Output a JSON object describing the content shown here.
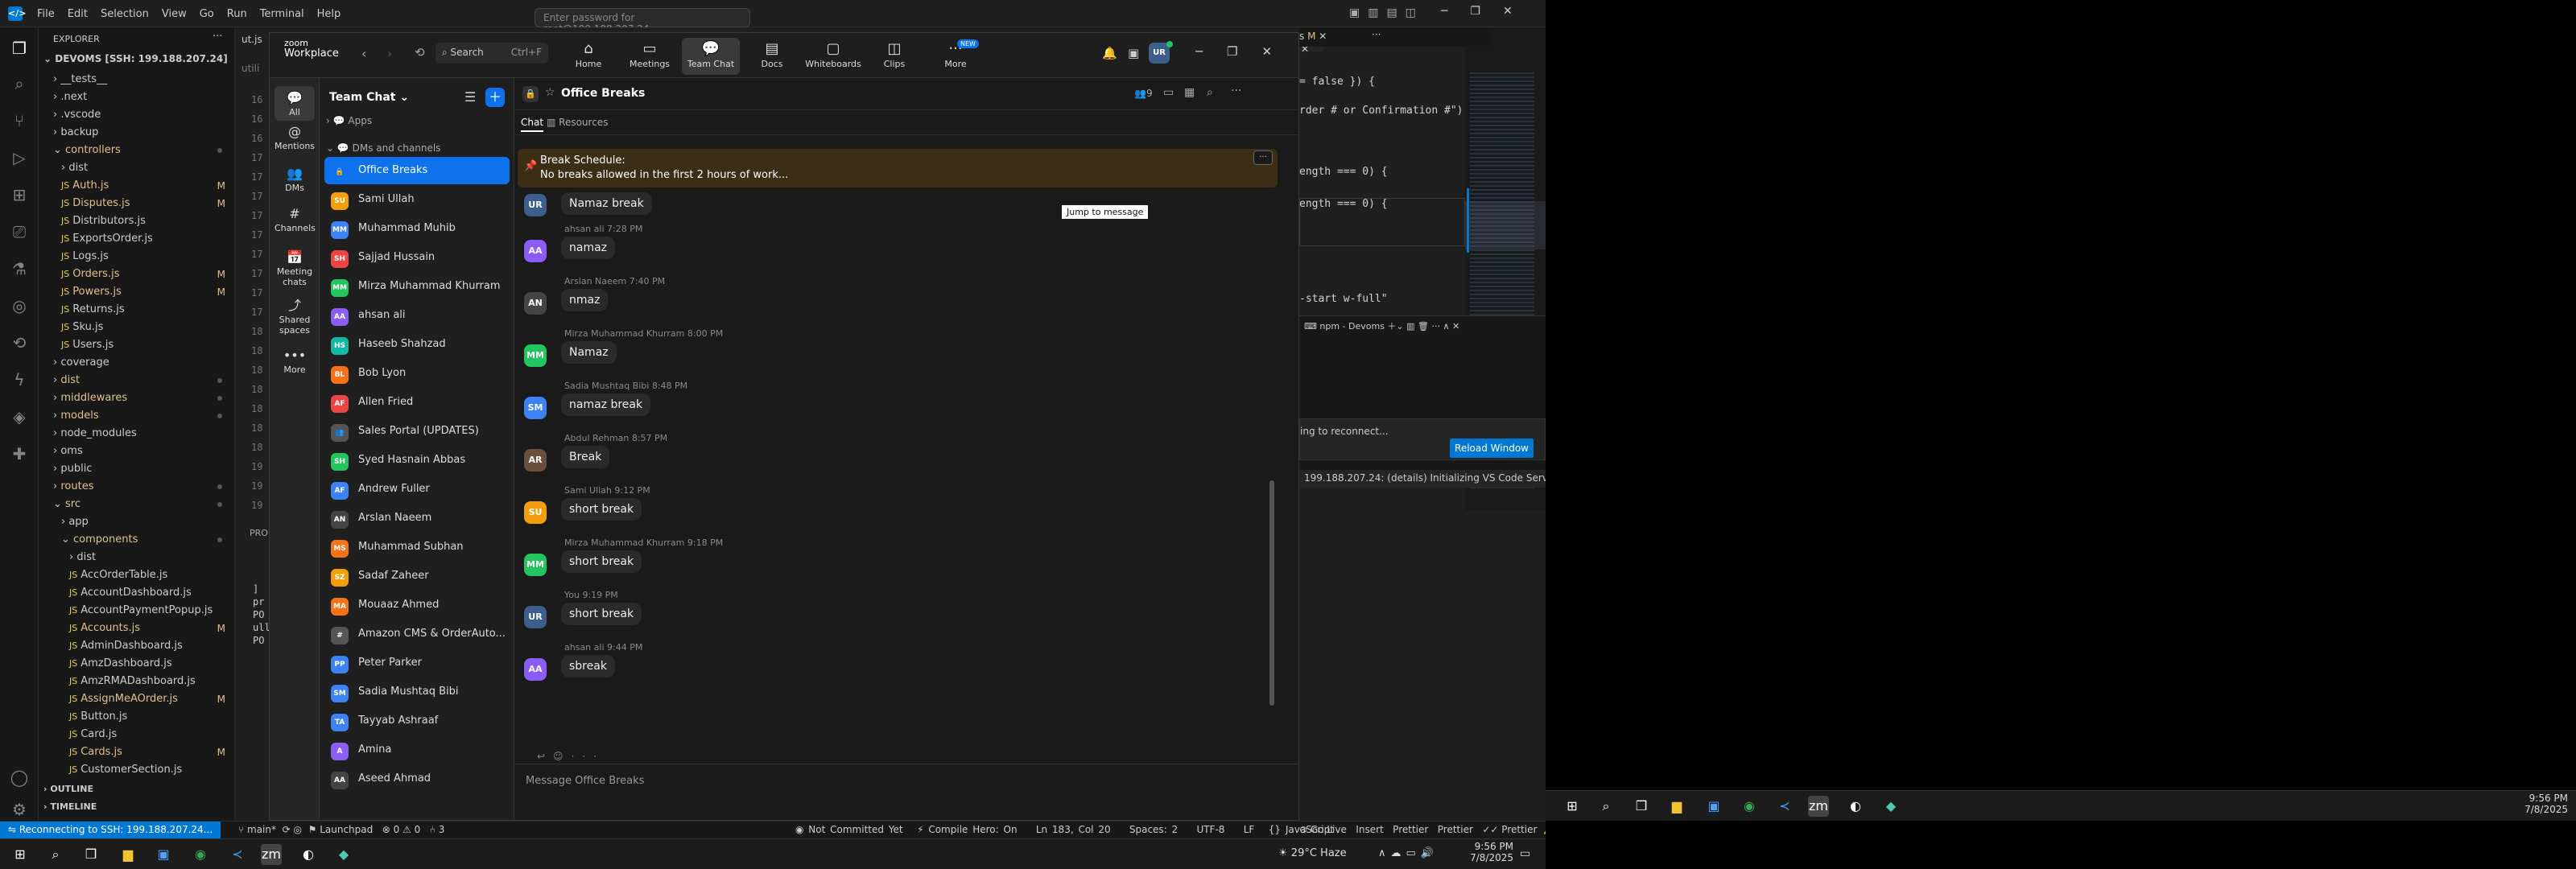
{
  "vscode": {
    "menu": [
      "File",
      "Edit",
      "Selection",
      "View",
      "Go",
      "Run",
      "Terminal",
      "Help"
    ],
    "command_center": "Enter password for root@199.188.207.24",
    "explorer_title": "EXPLORER",
    "root_folder": "DEVOMS [SSH: 199.188.207.24]",
    "tree": [
      {
        "label": "__tests__",
        "depth": 1,
        "type": "folder"
      },
      {
        "label": ".next",
        "depth": 1,
        "type": "folder"
      },
      {
        "label": ".vscode",
        "depth": 1,
        "type": "folder"
      },
      {
        "label": "backup",
        "depth": 1,
        "type": "folder"
      },
      {
        "label": "controllers",
        "depth": 1,
        "type": "folder-open",
        "dot": true
      },
      {
        "label": "dist",
        "depth": 2,
        "type": "folder"
      },
      {
        "label": "Auth.js",
        "depth": 2,
        "type": "js",
        "mark": "M"
      },
      {
        "label": "Disputes.js",
        "depth": 2,
        "type": "js",
        "mark": "M"
      },
      {
        "label": "Distributors.js",
        "depth": 2,
        "type": "js"
      },
      {
        "label": "ExportsOrder.js",
        "depth": 2,
        "type": "js"
      },
      {
        "label": "Logs.js",
        "depth": 2,
        "type": "js"
      },
      {
        "label": "Orders.js",
        "depth": 2,
        "type": "js",
        "mark": "M"
      },
      {
        "label": "Powers.js",
        "depth": 2,
        "type": "js",
        "mark": "M"
      },
      {
        "label": "Returns.js",
        "depth": 2,
        "type": "js"
      },
      {
        "label": "Sku.js",
        "depth": 2,
        "type": "js"
      },
      {
        "label": "Users.js",
        "depth": 2,
        "type": "js"
      },
      {
        "label": "coverage",
        "depth": 1,
        "type": "folder"
      },
      {
        "label": "dist",
        "depth": 1,
        "type": "folder",
        "dot": true
      },
      {
        "label": "middlewares",
        "depth": 1,
        "type": "folder",
        "dot": true
      },
      {
        "label": "models",
        "depth": 1,
        "type": "folder",
        "dot": true
      },
      {
        "label": "node_modules",
        "depth": 1,
        "type": "folder"
      },
      {
        "label": "oms",
        "depth": 1,
        "type": "folder"
      },
      {
        "label": "public",
        "depth": 1,
        "type": "folder"
      },
      {
        "label": "routes",
        "depth": 1,
        "type": "folder",
        "dot": true
      },
      {
        "label": "src",
        "depth": 1,
        "type": "folder-open",
        "dot": true
      },
      {
        "label": "app",
        "depth": 2,
        "type": "folder"
      },
      {
        "label": "components",
        "depth": 2,
        "type": "folder-open",
        "dot": true
      },
      {
        "label": "dist",
        "depth": 3,
        "type": "folder"
      },
      {
        "label": "AccOrderTable.js",
        "depth": 3,
        "type": "js"
      },
      {
        "label": "AccountDashboard.js",
        "depth": 3,
        "type": "js"
      },
      {
        "label": "AccountPaymentPopup.js",
        "depth": 3,
        "type": "js"
      },
      {
        "label": "Accounts.js",
        "depth": 3,
        "type": "js",
        "mark": "M"
      },
      {
        "label": "AdminDashboard.js",
        "depth": 3,
        "type": "js"
      },
      {
        "label": "AmzDashboard.js",
        "depth": 3,
        "type": "js"
      },
      {
        "label": "AmzRMADashboard.js",
        "depth": 3,
        "type": "js"
      },
      {
        "label": "AssignMeAOrder.js",
        "depth": 3,
        "type": "js",
        "mark": "M"
      },
      {
        "label": "Button.js",
        "depth": 3,
        "type": "js"
      },
      {
        "label": "Card.js",
        "depth": 3,
        "type": "js"
      },
      {
        "label": "Cards.js",
        "depth": 3,
        "type": "js",
        "mark": "M"
      },
      {
        "label": "CustomerSection.js",
        "depth": 3,
        "type": "js"
      }
    ],
    "outline": "OUTLINE",
    "timeline": "TIMELINE",
    "code_snippets": [
      "= false }) {",
      "rder # or Confirmation #\")",
      "ength === 0) {",
      "ength === 0) {",
      "-start w-full\""
    ],
    "terminal_tab": "npm - Devoms",
    "reconnect_text": "ing to reconnect...",
    "reload_button": "Reload Window",
    "notification": "199.188.207.24: (details) Initializing VS Code Server",
    "notification_link": "details",
    "status": {
      "remote": "Reconnecting to SSH: 199.188.207.24...",
      "branch": "main*",
      "launchpad": "Launchpad",
      "problems": "0 ⚠ 0",
      "ports": "3",
      "commit": "Not Committed Yet",
      "compile": "Compile Hero: On",
      "position": "Ln 183, Col 20",
      "spaces": "Spaces: 2",
      "encoding": "UTF-8",
      "eol": "LF",
      "language": "JavaScript",
      "golive": "Go Live",
      "insert": "Insert",
      "prettier1": "Prettier",
      "prettier2": "Prettier",
      "prettier3": "Prettier"
    },
    "line_numbers": [
      "16",
      "16",
      "16",
      "17",
      "17",
      "17",
      "17",
      "17",
      "17",
      "17",
      "17",
      "17",
      "18",
      "18",
      "18",
      "18",
      "18",
      "18",
      "18",
      "19",
      "19",
      "19"
    ]
  },
  "zoom": {
    "brand_top": "zoom",
    "brand_bottom": "Workplace",
    "search": "Search",
    "search_shortcut": "Ctrl+F",
    "nav": [
      {
        "label": "Home",
        "icon": "home-icon"
      },
      {
        "label": "Meetings",
        "icon": "video-icon"
      },
      {
        "label": "Team Chat",
        "icon": "chat-icon",
        "active": true
      },
      {
        "label": "Docs",
        "icon": "doc-icon"
      },
      {
        "label": "Whiteboards",
        "icon": "whiteboard-icon"
      },
      {
        "label": "Clips",
        "icon": "clips-icon"
      },
      {
        "label": "More",
        "icon": "more-icon",
        "badge": "NEW"
      }
    ],
    "avatar_initials": "UR",
    "left_nav": [
      {
        "label": "All",
        "icon": "💬",
        "active": true
      },
      {
        "label": "Mentions",
        "icon": "@"
      },
      {
        "label": "DMs",
        "icon": "👥"
      },
      {
        "label": "Channels",
        "icon": "#"
      },
      {
        "label": "Meeting chats",
        "icon": "📅"
      },
      {
        "label": "Shared spaces",
        "icon": "⤴"
      },
      {
        "label": "More",
        "icon": "•••"
      }
    ],
    "list_title": "Team Chat",
    "sections": {
      "apps": "Apps",
      "dms": "DMs and channels"
    },
    "contacts": [
      {
        "name": "Office Breaks",
        "initials": "🔒",
        "color": "#0e72ed",
        "active": true
      },
      {
        "name": "Sami Ullah",
        "initials": "SU",
        "color": "#f59e0b"
      },
      {
        "name": "Muhammad Muhib",
        "initials": "MM",
        "color": "#3b82f6"
      },
      {
        "name": "Sajjad Hussain",
        "initials": "SH",
        "color": "#ef4444"
      },
      {
        "name": "Mirza Muhammad Khurram",
        "initials": "MM",
        "color": "#22c55e"
      },
      {
        "name": "ahsan ali",
        "initials": "AA",
        "color": "#8b5cf6"
      },
      {
        "name": "Haseeb Shahzad",
        "initials": "HS",
        "color": "#14b8a6"
      },
      {
        "name": "Bob Lyon",
        "initials": "BL",
        "color": "#f97316"
      },
      {
        "name": "Allen Fried",
        "initials": "AF",
        "color": "#ef4444"
      },
      {
        "name": "Sales Portal (UPDATES)",
        "initials": "👥",
        "color": "#555"
      },
      {
        "name": "Syed Hasnain Abbas",
        "initials": "SH",
        "color": "#22c55e"
      },
      {
        "name": "Andrew Fuller",
        "initials": "AF",
        "color": "#3b82f6"
      },
      {
        "name": "Arslan Naeem",
        "initials": "AN",
        "color": "#444"
      },
      {
        "name": "Muhammad Subhan",
        "initials": "MS",
        "color": "#f97316"
      },
      {
        "name": "Sadaf Zaheer",
        "initials": "SZ",
        "color": "#f59e0b"
      },
      {
        "name": "Mouaaz Ahmed",
        "initials": "MA",
        "color": "#f97316"
      },
      {
        "name": "Amazon CMS & OrderAuto...",
        "initials": "#",
        "color": "#555"
      },
      {
        "name": "Peter Parker",
        "initials": "PP",
        "color": "#3b82f6"
      },
      {
        "name": "Sadia Mushtaq Bibi",
        "initials": "SM",
        "color": "#3b82f6"
      },
      {
        "name": "Tayyab Ashraaf",
        "initials": "TA",
        "color": "#3b82f6"
      },
      {
        "name": "Amina",
        "initials": "A",
        "color": "#8b5cf6"
      },
      {
        "name": "Aseed Ahmad",
        "initials": "AA",
        "color": "#444"
      }
    ],
    "channel_title": "Office Breaks",
    "member_count": "9",
    "tabs": {
      "chat": "Chat",
      "resources": "Resources"
    },
    "pinned_title": "Break Schedule:",
    "pinned_body": "No breaks allowed in the first 2 hours of work...",
    "jump_tooltip": "Jump to message",
    "messages": [
      {
        "initials": "UR",
        "color": "#3b5f8a",
        "meta": "",
        "text": "Namaz break"
      },
      {
        "initials": "AA",
        "color": "#8b5cf6",
        "meta": "ahsan ali 7:28 PM",
        "text": "namaz"
      },
      {
        "initials": "AN",
        "color": "#444",
        "meta": "Arslan Naeem 7:40 PM",
        "text": "nmaz"
      },
      {
        "initials": "MM",
        "color": "#22c55e",
        "meta": "Mirza Muhammad Khurram 8:00 PM",
        "text": "Namaz"
      },
      {
        "initials": "SM",
        "color": "#3b82f6",
        "meta": "Sadia Mushtaq Bibi 8:48 PM",
        "text": "namaz  break"
      },
      {
        "initials": "AR",
        "color": "#6b4f3a",
        "meta": "Abdul Rehman 8:57 PM",
        "text": "Break"
      },
      {
        "initials": "SU",
        "color": "#f59e0b",
        "meta": "Sami Ullah 9:12 PM",
        "text": "short break"
      },
      {
        "initials": "MM",
        "color": "#22c55e",
        "meta": "Mirza Muhammad Khurram 9:18 PM",
        "text": "short break"
      },
      {
        "initials": "UR",
        "color": "#3b5f8a",
        "meta": "You 9:19 PM",
        "text": "short break"
      },
      {
        "initials": "AA",
        "color": "#8b5cf6",
        "meta": "ahsan ali 9:44 PM",
        "text": "sbreak"
      }
    ],
    "composer_placeholder": "Message Office Breaks"
  },
  "taskbar": {
    "weather": "29°C  Haze",
    "time": "9:56 PM",
    "date": "7/8/2025",
    "time2": "9:56 PM",
    "date2": "7/8/2025"
  }
}
